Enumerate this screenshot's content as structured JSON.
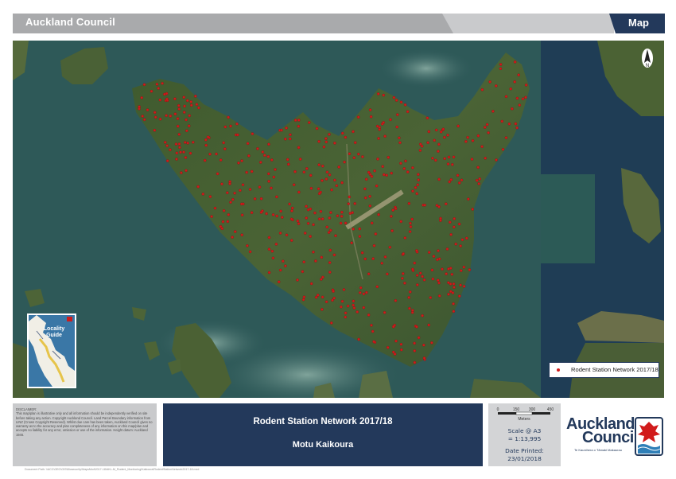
{
  "header": {
    "org_name": "Auckland Council",
    "map_label": "Map"
  },
  "map": {
    "north_arrow_label": "N",
    "locality_guide": {
      "line1": "Locality",
      "line2": "Guide"
    },
    "legend": {
      "label": "Rodent Station Network 2017/18",
      "marker_color": "#d11b1b",
      "marker_icon": "dot-icon"
    }
  },
  "disclaimer": {
    "heading": "DISCLAIMER:",
    "body": "This map/plan is illustrative only and all information should be independently verified on site before taking any action. Copyright Auckland Council. Land Parcel Boundary information from LINZ (Crown Copyright Reserved). Whilst due care has been taken, Auckland Council gives no warranty as to the accuracy and plan completeness of any information on this map/plan and accepts no liability for any error, omission or use of the information. Height datum: Auckland 1946."
  },
  "title_block": {
    "title": "Rodent Station Network 2017/18",
    "subtitle": "Motu Kaikoura"
  },
  "scale_block": {
    "scale_bar_ticks": [
      "0",
      "150",
      "300",
      "450"
    ],
    "scale_bar_unit": "Meters",
    "scale_label": "Scale @ A3",
    "scale_value": "= 1:13,995",
    "date_label": "Date Printed:",
    "date_value": "23/01/2018"
  },
  "logo": {
    "line1": "Auckland",
    "line2": "Council",
    "tagline": "Te Kaunihera o Tāmaki Makaurau"
  },
  "footer": {
    "path_text": "Document Path: \\\\ACC\\GEO\\GIS\\Biosecurity\\MapsMxd\\2017-18\\AKL-M_Rodent_Monitoring\\Kaikoura\\RodentStationNetwork2017-18.mxd"
  },
  "colors": {
    "brand_navy": "#23395b",
    "header_grey": "#a9aaac",
    "panel_grey": "#c9cacc",
    "station_red": "#d11b1b"
  }
}
